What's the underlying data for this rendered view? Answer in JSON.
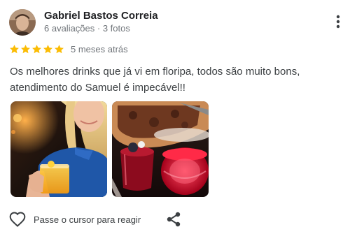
{
  "reviewer": {
    "name": "Gabriel Bastos Correia",
    "meta": "6 avaliações · 3 fotos"
  },
  "review": {
    "rating": 5,
    "rating_max": 5,
    "date": "5 meses atrás",
    "text": "Os melhores drinks que já vi em floripa, todos são muito bons, atendimento do Samuel é impecável!!"
  },
  "photos": [
    {
      "subject": "woman-holding-orange-drink"
    },
    {
      "subject": "red-drinks-and-pizza"
    }
  ],
  "actions": {
    "react_label": "Passe o cursor para reagir"
  },
  "colors": {
    "star": "#fbbc04",
    "name": "#202124",
    "secondary": "#70757a",
    "body_text": "#3c4043",
    "icon": "#5f6368"
  },
  "icons": {
    "more": "more-vert-icon",
    "star": "star-icon",
    "heart": "heart-outline-icon",
    "share": "share-icon"
  }
}
